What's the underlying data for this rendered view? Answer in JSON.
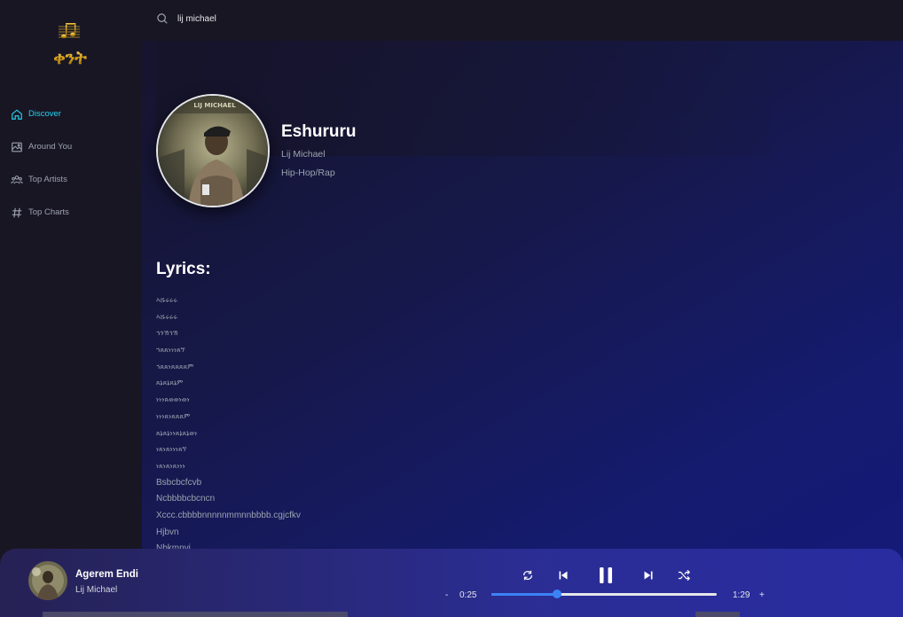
{
  "app": {
    "logo_text": "ቀንት"
  },
  "sidebar": {
    "items": [
      {
        "label": "Discover",
        "icon": "home-icon",
        "active": true
      },
      {
        "label": "Around You",
        "icon": "image-icon",
        "active": false
      },
      {
        "label": "Top Artists",
        "icon": "users-icon",
        "active": false
      },
      {
        "label": "Top Charts",
        "icon": "hashtag-icon",
        "active": false
      }
    ]
  },
  "search": {
    "value": "lij michael",
    "icon": "search-icon"
  },
  "song": {
    "title": "Eshururu",
    "artist": "Lij Michael",
    "genre": "Hip-Hop/Rap"
  },
  "lyrics": {
    "heading": "Lyrics:",
    "lines": [
      "እሹሩሩሩ",
      "እሹሩሩሩ",
      "ኅንኽኅኽ",
      "ኀጸጸነነነጸኘ",
      "ኅጸጸነጸጸጸጸም",
      "ጸኔጸኔጸኔም",
      "ነነነጸወወነወነ",
      "ነነነጸነጸጸጸም",
      "ጸኔጸኔነነጸኔጸኔወነ",
      "ነጸነጸነነነጸኘ",
      "ነጸነጸነጸነነነ",
      "Bsbcbcfcvb",
      "Ncbbbbcbcncn",
      "Xccc.cbbbbnnnnnmmnnbbbb.cgjcfkv",
      "Hjbvn",
      "Nbkmnvj"
    ]
  },
  "player": {
    "title": "Agerem Endi",
    "artist": "Lij Michael",
    "current_time": "0:25",
    "total_time": "1:29",
    "progress_fraction": 0.29,
    "minus_label": "-",
    "plus_label": "+"
  },
  "colors": {
    "accent": "#22d3ee",
    "progress": "#3b82f6"
  }
}
